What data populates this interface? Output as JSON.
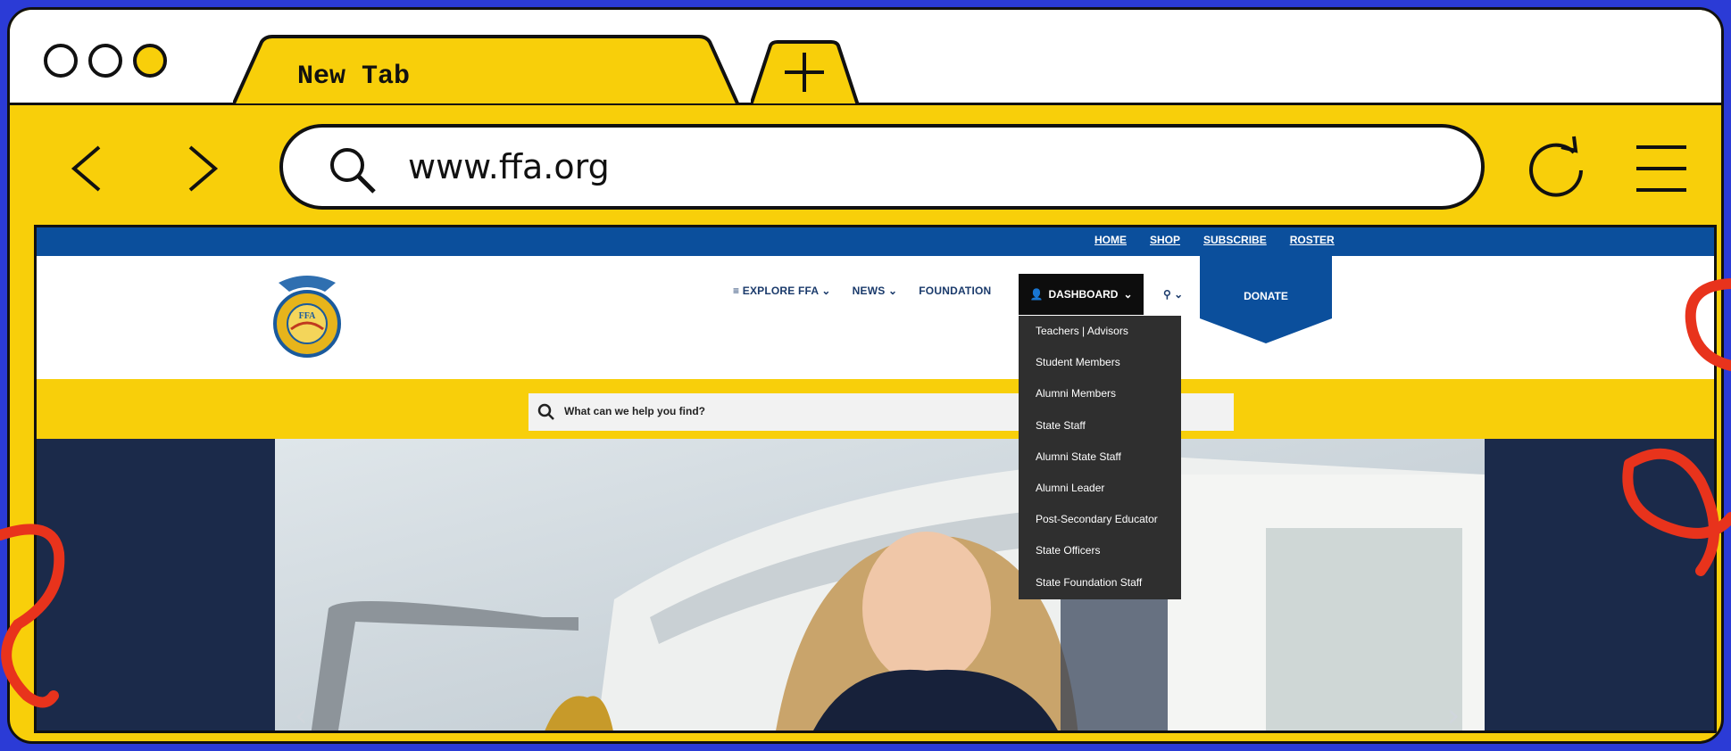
{
  "browser": {
    "tab_title": "New Tab",
    "new_tab_symbol": "+",
    "back_symbol": "<",
    "forward_symbol": ">",
    "url": "www.ffa.org"
  },
  "site": {
    "top_links": [
      "HOME",
      "SHOP",
      "SUBSCRIBE",
      "ROSTER"
    ],
    "nav": {
      "explore": "EXPLORE FFA",
      "news": "NEWS",
      "foundation": "FOUNDATION",
      "dashboard": "DASHBOARD",
      "donate": "DONATE"
    },
    "logo_text": "FFA",
    "search_placeholder": "What can we help you find?",
    "dashboard_menu": [
      "Teachers | Advisors",
      "Student Members",
      "Alumni Members",
      "State Staff",
      "Alumni State Staff",
      "Alumni Leader",
      "Post-Secondary Educator",
      "State Officers",
      "State Foundation Staff"
    ],
    "carousel_prev": "‹",
    "carousel_next": "›"
  },
  "colors": {
    "frame_yellow": "#f8cf0a",
    "background_blue": "#2b3bd6",
    "ffa_blue": "#0b4f9c",
    "hero_navy": "#1b2a4a",
    "squiggle_red": "#e8331c"
  },
  "icons": [
    "search-icon",
    "reload-icon",
    "hamburger-menu-icon",
    "user-icon",
    "chevron-down-icon"
  ]
}
